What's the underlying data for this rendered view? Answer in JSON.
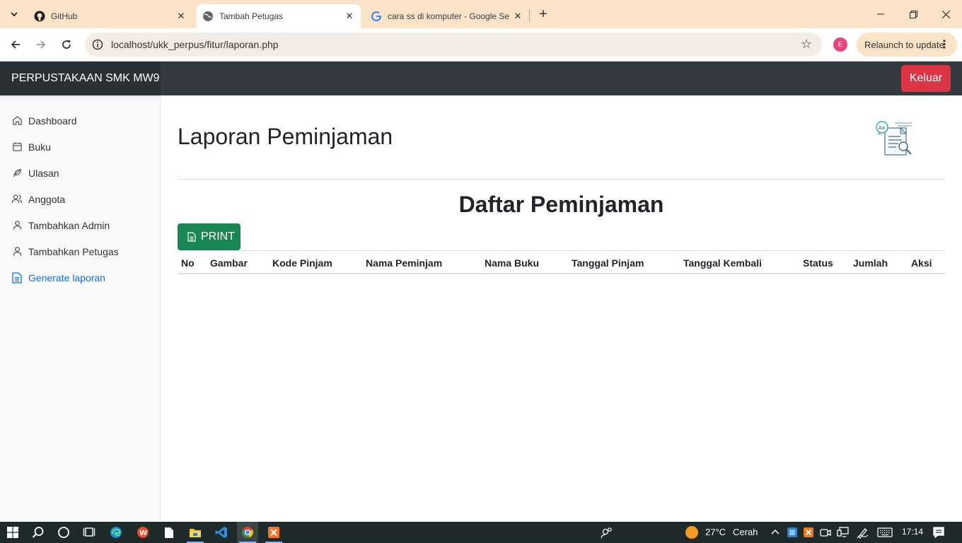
{
  "browser": {
    "tabs": [
      {
        "label": "GitHub",
        "icon": "github-icon",
        "active": false
      },
      {
        "label": "Tambah Petugas",
        "icon": "globe-icon",
        "active": true
      },
      {
        "label": "cara ss di komputer - Google Se",
        "icon": "google-icon",
        "active": false
      }
    ],
    "url": "localhost/ukk_perpus/fitur/laporan.php",
    "profile_initial": "E",
    "relaunch_label": "Relaunch to update"
  },
  "app": {
    "brand": "PERPUSTAKAAN SMK MW9",
    "logout_label": "Keluar"
  },
  "sidebar": {
    "items": [
      {
        "label": "Dashboard",
        "icon": "home-icon"
      },
      {
        "label": "Buku",
        "icon": "calendar-icon"
      },
      {
        "label": "Ulasan",
        "icon": "feather-icon"
      },
      {
        "label": "Anggota",
        "icon": "users-icon"
      },
      {
        "label": "Tambahkan Admin",
        "icon": "user-icon"
      },
      {
        "label": "Tambahkan Petugas",
        "icon": "user-icon"
      },
      {
        "label": "Generate laporan",
        "icon": "file-text-icon",
        "active": true
      }
    ]
  },
  "main": {
    "title": "Laporan Peminjaman",
    "list_title": "Daftar Peminjaman",
    "print_label": "PRINT",
    "columns": [
      "No",
      "Gambar",
      "Kode Pinjam",
      "Nama Peminjam",
      "Nama Buku",
      "Tanggal Pinjam",
      "Tanggal Kembali",
      "Status",
      "Jumlah",
      "Aksi"
    ]
  },
  "taskbar": {
    "weather_temp": "27°C",
    "weather_desc": "Cerah",
    "time": "17:14"
  },
  "colors": {
    "accent_blue": "#0d6efd",
    "danger": "#dc3545",
    "success": "#198754",
    "navbar": "#343a40",
    "tabstrip": "#fbe3c8"
  }
}
